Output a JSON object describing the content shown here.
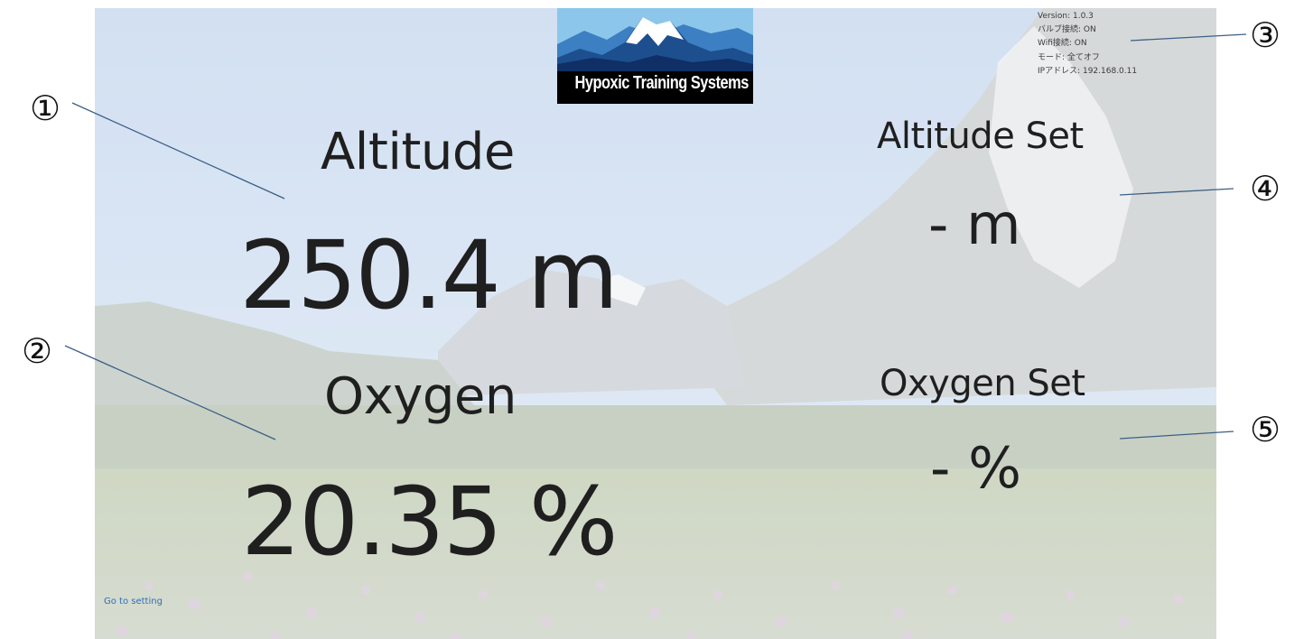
{
  "logo": {
    "text": "Hypoxic Training Systems"
  },
  "status": {
    "version": "Version: 1.0.3",
    "valve": "バルブ接続: ON",
    "wifi": "Wifi接続: ON",
    "mode": "モード: 全てオフ",
    "ip": "IPアドレス: 192.168.0.11"
  },
  "altitude": {
    "label": "Altitude",
    "value": "250.4 m"
  },
  "oxygen": {
    "label": "Oxygen",
    "value": "20.35 %"
  },
  "altitude_set": {
    "label": "Altitude Set",
    "value": "- m"
  },
  "oxygen_set": {
    "label": "Oxygen Set",
    "value": "- %"
  },
  "footer": {
    "setting_link": "Go to setting"
  },
  "callouts": [
    "①",
    "②",
    "③",
    "④",
    "⑤"
  ],
  "colors": {
    "callout_line": "#3d5f86",
    "link": "#2f6fb5",
    "text": "#1f1f1f"
  }
}
